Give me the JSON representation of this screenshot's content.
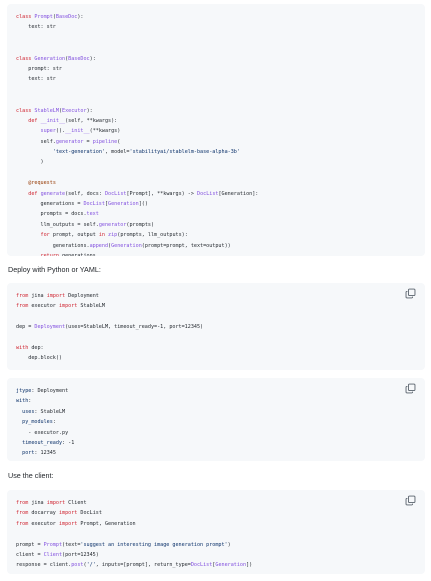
{
  "icons": {
    "copy": "copy-icon"
  },
  "blocks": [
    {
      "name": "executor-code-block",
      "has_copy": false,
      "lines": [
        [
          [
            "k",
            "class "
          ],
          [
            "f",
            "Prompt"
          ],
          [
            "t",
            "("
          ],
          [
            "f",
            "BaseDoc"
          ],
          [
            "t",
            "):"
          ]
        ],
        [
          [
            "t",
            "    text: str"
          ]
        ],
        [],
        [],
        [
          [
            "k",
            "class "
          ],
          [
            "f",
            "Generation"
          ],
          [
            "t",
            "("
          ],
          [
            "f",
            "BaseDoc"
          ],
          [
            "t",
            "):"
          ]
        ],
        [
          [
            "t",
            "    prompt: str"
          ]
        ],
        [
          [
            "t",
            "    text: str"
          ]
        ],
        [],
        [],
        [
          [
            "k",
            "class "
          ],
          [
            "f",
            "StableLM"
          ],
          [
            "t",
            "("
          ],
          [
            "f",
            "Executor"
          ],
          [
            "t",
            "):"
          ]
        ],
        [
          [
            "t",
            "    "
          ],
          [
            "k",
            "def "
          ],
          [
            "f",
            "__init__"
          ],
          [
            "t",
            "(self, **kwargs):"
          ]
        ],
        [
          [
            "t",
            "        "
          ],
          [
            "f",
            "super"
          ],
          [
            "t",
            "()."
          ],
          [
            "f",
            "__init__"
          ],
          [
            "t",
            "(**kwargs)"
          ]
        ],
        [
          [
            "t",
            "        self."
          ],
          [
            "f",
            "generator"
          ],
          [
            "t",
            " = "
          ],
          [
            "f",
            "pipeline"
          ],
          [
            "t",
            "("
          ]
        ],
        [
          [
            "t",
            "            "
          ],
          [
            "s",
            "'text-generation'"
          ],
          [
            "t",
            ", model="
          ],
          [
            "s",
            "'stabilityai/stablelm-base-alpha-3b'"
          ]
        ],
        [
          [
            "t",
            "        )"
          ]
        ],
        [],
        [
          [
            "t",
            "    "
          ],
          [
            "d",
            "@requests"
          ]
        ],
        [
          [
            "t",
            "    "
          ],
          [
            "k",
            "def "
          ],
          [
            "f",
            "generate"
          ],
          [
            "t",
            "(self, docs: "
          ],
          [
            "f",
            "DocList"
          ],
          [
            "t",
            "[Prompt], **kwargs) -> "
          ],
          [
            "f",
            "DocList"
          ],
          [
            "t",
            "[Generation]:"
          ]
        ],
        [
          [
            "t",
            "        generations = "
          ],
          [
            "f",
            "DocList"
          ],
          [
            "t",
            "["
          ],
          [
            "f",
            "Generation"
          ],
          [
            "t",
            "]()"
          ]
        ],
        [
          [
            "t",
            "        prompts = docs."
          ],
          [
            "f",
            "text"
          ]
        ],
        [
          [
            "t",
            "        llm_outputs = self."
          ],
          [
            "f",
            "generator"
          ],
          [
            "t",
            "(prompts)"
          ]
        ],
        [
          [
            "t",
            "        "
          ],
          [
            "k",
            "for "
          ],
          [
            "t",
            "prompt, output "
          ],
          [
            "k",
            "in "
          ],
          [
            "f",
            "zip"
          ],
          [
            "t",
            "(prompts, llm_outputs):"
          ]
        ],
        [
          [
            "t",
            "            generations."
          ],
          [
            "f",
            "append"
          ],
          [
            "t",
            "("
          ],
          [
            "f",
            "Generation"
          ],
          [
            "t",
            "(prompt=prompt, text=output))"
          ]
        ],
        [
          [
            "t",
            "        "
          ],
          [
            "k",
            "return "
          ],
          [
            "t",
            "generations"
          ]
        ]
      ]
    },
    {
      "name": "deploy-python-code-block",
      "has_copy": true,
      "lines": [
        [
          [
            "k",
            "from "
          ],
          [
            "t",
            "jina "
          ],
          [
            "k",
            "import "
          ],
          [
            "t",
            "Deployment"
          ]
        ],
        [
          [
            "k",
            "from "
          ],
          [
            "t",
            "executor "
          ],
          [
            "k",
            "import "
          ],
          [
            "t",
            "StableLM"
          ]
        ],
        [],
        [
          [
            "t",
            "dep = "
          ],
          [
            "f",
            "Deployment"
          ],
          [
            "t",
            "(uses=StableLM, timeout_ready=-1, port=12345)"
          ]
        ],
        [],
        [
          [
            "k",
            "with "
          ],
          [
            "t",
            "dep:"
          ]
        ],
        [
          [
            "t",
            "    dep.block()"
          ]
        ]
      ]
    },
    {
      "name": "deploy-yaml-code-block",
      "has_copy": true,
      "lines": [
        [
          [
            "s",
            "jtype"
          ],
          [
            "t",
            ": Deployment"
          ]
        ],
        [
          [
            "s",
            "with"
          ],
          [
            "t",
            ":"
          ]
        ],
        [
          [
            "t",
            "  "
          ],
          [
            "s",
            "uses"
          ],
          [
            "t",
            ": StableLM"
          ]
        ],
        [
          [
            "t",
            "  "
          ],
          [
            "s",
            "py_modules"
          ],
          [
            "t",
            ":"
          ]
        ],
        [
          [
            "t",
            "    - executor.py"
          ]
        ],
        [
          [
            "t",
            "  "
          ],
          [
            "s",
            "timeout_ready"
          ],
          [
            "t",
            ": -1"
          ]
        ],
        [
          [
            "t",
            "  "
          ],
          [
            "s",
            "port"
          ],
          [
            "t",
            ": 12345"
          ]
        ]
      ]
    },
    {
      "name": "client-code-block",
      "has_copy": true,
      "lines": [
        [
          [
            "k",
            "from "
          ],
          [
            "t",
            "jina "
          ],
          [
            "k",
            "import "
          ],
          [
            "t",
            "Client"
          ]
        ],
        [
          [
            "k",
            "from "
          ],
          [
            "t",
            "docarray "
          ],
          [
            "k",
            "import "
          ],
          [
            "t",
            "DocList"
          ]
        ],
        [
          [
            "k",
            "from "
          ],
          [
            "t",
            "executor "
          ],
          [
            "k",
            "import "
          ],
          [
            "t",
            "Prompt, Generation"
          ]
        ],
        [],
        [
          [
            "t",
            "prompt = "
          ],
          [
            "f",
            "Prompt"
          ],
          [
            "t",
            "(text="
          ],
          [
            "s",
            "'suggest an interesting image generation prompt'"
          ],
          [
            "t",
            ")"
          ]
        ],
        [
          [
            "t",
            "client = "
          ],
          [
            "f",
            "Client"
          ],
          [
            "t",
            "(port=12345)"
          ]
        ],
        [
          [
            "t",
            "response = client."
          ],
          [
            "f",
            "post"
          ],
          [
            "t",
            "("
          ],
          [
            "s",
            "'/'"
          ],
          [
            "t",
            ", inputs=[prompt], return_type="
          ],
          [
            "f",
            "DocList"
          ],
          [
            "t",
            "["
          ],
          [
            "f",
            "Generation"
          ],
          [
            "t",
            "])"
          ]
        ]
      ]
    }
  ],
  "prose": {
    "deploy_text": "Deploy with Python or YAML:",
    "client_text": "Use the client:"
  }
}
